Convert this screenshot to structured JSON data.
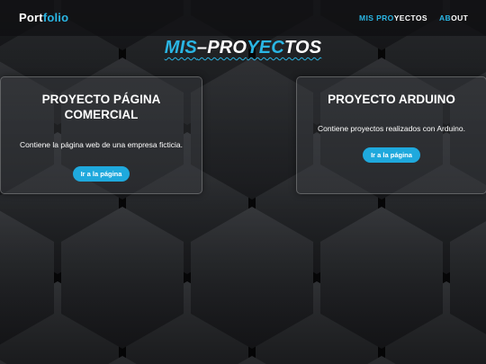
{
  "navbar": {
    "brand_part1": "Port",
    "brand_part2": "folio",
    "projects_part1": "MIS PRO",
    "projects_part2": "YECTOS",
    "about_part1": "AB",
    "about_part2": "OUT"
  },
  "page_title": {
    "part1": "MIS",
    "part2": "–PRO",
    "part3": "YEC",
    "part4": "TOS"
  },
  "cards": [
    {
      "title": "PROYECTO PÁGINA COMERCIAL",
      "description": "Contiene la página web de una empresa ficticia.",
      "button": "Ir a la página"
    },
    {
      "title": "PROYECTO ARDUINO",
      "description": "Contiene proyectos realizados con Arduino.",
      "button": "Ir a la página"
    }
  ],
  "colors": {
    "accent": "#2ab6e4",
    "button": "#1fa9dd",
    "text": "#ffffff"
  }
}
